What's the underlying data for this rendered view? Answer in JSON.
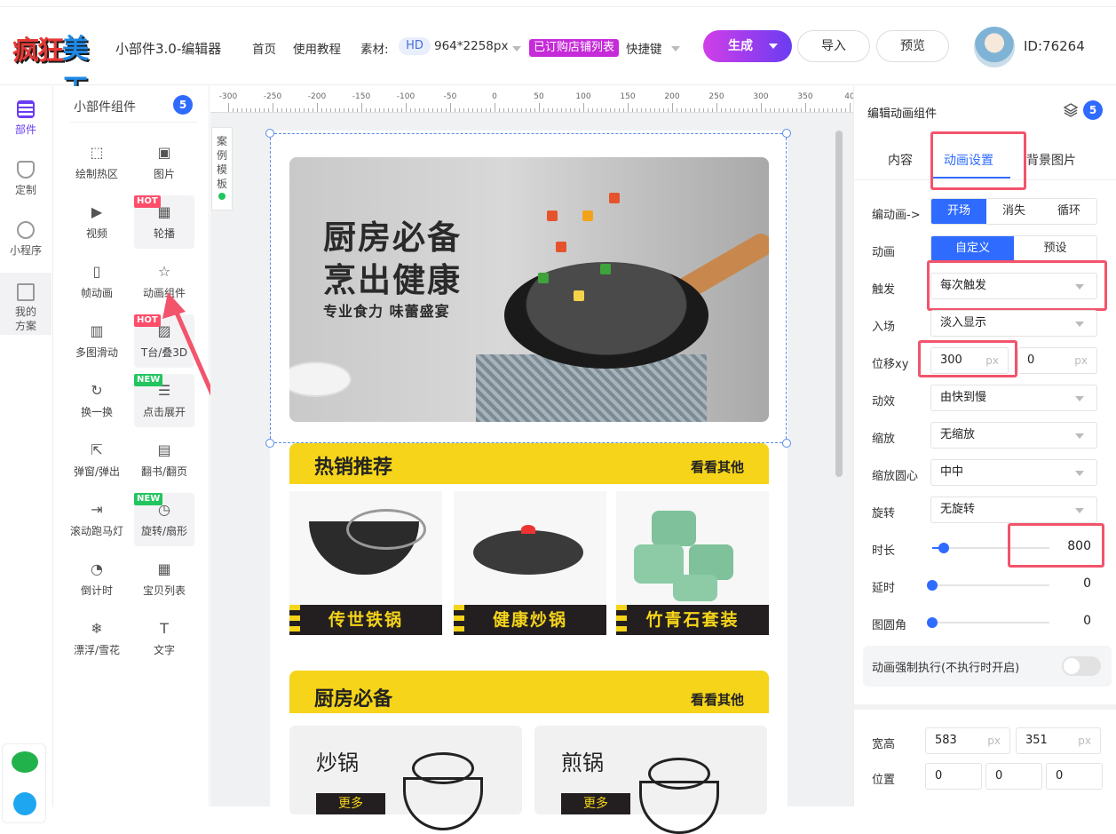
{
  "header": {
    "logo_text_1": "疯狂",
    "logo_text_2": "美工",
    "app_title": "小部件3.0-编辑器",
    "nav": [
      "首页",
      "使用教程"
    ],
    "material_label": "素材:",
    "hd_badge": "HD",
    "size_text": "964*2258px",
    "shop_tag": "已订购店铺列表",
    "shortcut": "快捷键",
    "generate_button": "生成",
    "import_button": "导入",
    "preview_button": "预览",
    "user_id": "ID:76264"
  },
  "rail": [
    {
      "label": "部件",
      "active": true
    },
    {
      "label": "定制"
    },
    {
      "label": "小程序"
    },
    {
      "label": "我的方案"
    }
  ],
  "component_panel": {
    "title": "小部件组件",
    "count": "5",
    "items": [
      {
        "label": "绘制热区",
        "icon": "hotzone-icon",
        "glyph": "⬚"
      },
      {
        "label": "图片",
        "icon": "image-icon",
        "glyph": "▣"
      },
      {
        "label": "视频",
        "icon": "video-icon",
        "glyph": "▶"
      },
      {
        "label": "轮播",
        "icon": "carousel-icon",
        "glyph": "▦",
        "tag": "HOT"
      },
      {
        "label": "帧动画",
        "icon": "frame-icon",
        "glyph": "▯"
      },
      {
        "label": "动画组件",
        "icon": "star-icon",
        "glyph": "☆"
      },
      {
        "label": "多图滑动",
        "icon": "slides-icon",
        "glyph": "▥"
      },
      {
        "label": "T台/叠3D",
        "icon": "stage-icon",
        "glyph": "▨",
        "tag": "HOT"
      },
      {
        "label": "换一换",
        "icon": "refresh-icon",
        "glyph": "↻"
      },
      {
        "label": "点击展开",
        "icon": "expand-icon",
        "glyph": "☰",
        "tag": "NEW"
      },
      {
        "label": "弹窗/弹出",
        "icon": "popup-icon",
        "glyph": "⇱"
      },
      {
        "label": "翻书/翻页",
        "icon": "book-icon",
        "glyph": "▤"
      },
      {
        "label": "滚动跑马灯",
        "icon": "marquee-icon",
        "glyph": "⇥"
      },
      {
        "label": "旋转/扇形",
        "icon": "rotate-icon",
        "glyph": "◷",
        "tag": "NEW"
      },
      {
        "label": "倒计时",
        "icon": "clock-icon",
        "glyph": "◔"
      },
      {
        "label": "宝贝列表",
        "icon": "grid-icon",
        "glyph": "▦"
      },
      {
        "label": "漂浮/雪花",
        "icon": "snowflake-icon",
        "glyph": "❄"
      },
      {
        "label": "文字",
        "icon": "text-icon",
        "glyph": "T"
      }
    ]
  },
  "ruler_labels": [
    "-300",
    "-250",
    "-200",
    "-150",
    "-100",
    "-50",
    "0",
    "50",
    "100",
    "150",
    "200",
    "250",
    "300",
    "350",
    "40"
  ],
  "case_template": "案例模板",
  "canvas": {
    "banner_line1": "厨房必备",
    "banner_line2": "烹出健康",
    "banner_line3": "专业食力  味蕾盛宴",
    "hot_title": "热销推荐",
    "more_1": "看看其他",
    "products": [
      "传世铁锅",
      "健康炒锅",
      "竹青石套装"
    ],
    "kitchen_title": "厨房必备",
    "more_2": "看看其他",
    "cats": [
      {
        "name": "炒锅",
        "more": "更多"
      },
      {
        "name": "煎锅",
        "more": "更多"
      }
    ]
  },
  "right_panel": {
    "title": "编辑动画组件",
    "count": "5",
    "tabs": [
      "内容",
      "动画设置",
      "背景图片"
    ],
    "edit_label": "编动画->",
    "edit_modes": [
      "开场",
      "消失",
      "循环"
    ],
    "anim_label": "动画",
    "anim_modes": [
      "自定义",
      "预设"
    ],
    "trigger_label": "触发",
    "trigger_value": "每次触发",
    "enter_label": "入场",
    "enter_value": "淡入显示",
    "offset_label": "位移xy",
    "offset_x": "300",
    "offset_y": "0",
    "unit_px": "px",
    "effect_label": "动效",
    "effect_value": "由快到慢",
    "scale_label": "缩放",
    "scale_value": "无缩放",
    "origin_label": "缩放圆心",
    "origin_value": "中中",
    "rotate_label": "旋转",
    "rotate_value": "无旋转",
    "duration_label": "时长",
    "duration_value": "800",
    "duration_level": 0.1,
    "delay_label": "延时",
    "delay_value": "0",
    "radius_label": "图圆角",
    "radius_value": "0",
    "force_label": "动画强制执行(不执行时开启)",
    "size_label": "宽高",
    "width": "583",
    "height": "351",
    "pos_label": "位置",
    "pos_values": [
      "0",
      "0",
      "0"
    ]
  },
  "colors": {
    "accent": "#2f6bff",
    "brand_purple": "#6a3cf2",
    "highlight_red": "#f2546c",
    "yellow": "#f5d41a"
  }
}
